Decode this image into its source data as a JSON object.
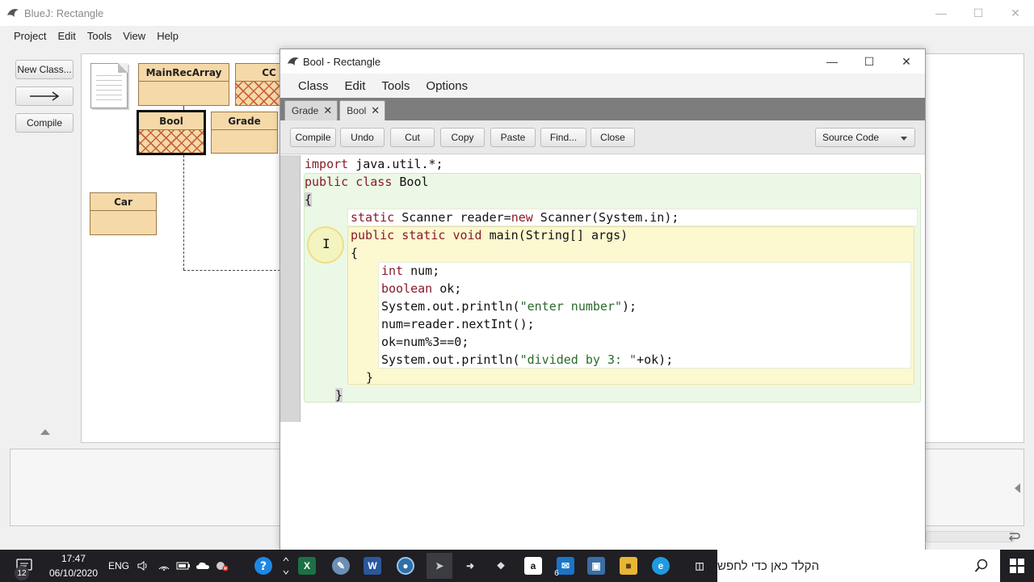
{
  "main_window": {
    "title": "BlueJ:  Rectangle",
    "menu": [
      "Project",
      "Edit",
      "Tools",
      "View",
      "Help"
    ],
    "toolbar": {
      "new_class": "New Class...",
      "compile": "Compile"
    }
  },
  "diagram": {
    "classes": {
      "main_rec_array": "MainRecArray",
      "cc": "CC",
      "bool": "Bool",
      "grade": "Grade",
      "car": "Car"
    }
  },
  "editor": {
    "title": "Bool - Rectangle",
    "menu": [
      "Class",
      "Edit",
      "Tools",
      "Options"
    ],
    "tabs": [
      {
        "label": "Grade",
        "close": "✕"
      },
      {
        "label": "Bool",
        "close": "✕"
      }
    ],
    "toolbar": {
      "compile": "Compile",
      "undo": "Undo",
      "cut": "Cut",
      "copy": "Copy",
      "paste": "Paste",
      "find": "Find...",
      "close": "Close",
      "view_mode": "Source Code"
    },
    "code": {
      "line1": {
        "kw": "import",
        "rest": " java.util.*;"
      },
      "line2": {
        "kw1": "public",
        "kw2": "class",
        "rest": " Bool"
      },
      "line3": "{",
      "line4": {
        "kw1": "static",
        "mid": " Scanner reader=",
        "kw2": "new",
        "rest": " Scanner(System.in);"
      },
      "line5": {
        "kw1": "public",
        "kw2": "static",
        "kw3": "void",
        "rest": " main(String[] args)"
      },
      "line6": "{",
      "line7": {
        "kw": "int",
        "rest": " num;"
      },
      "line8": {
        "kw": "boolean",
        "rest": " ok;"
      },
      "line9": {
        "pre": "System.out.println(",
        "str": "\"enter number\"",
        "post": ");"
      },
      "line10": "num=reader.nextInt();",
      "line11": "ok=num%3==0;",
      "line12": {
        "pre": "System.out.println(",
        "str": "\"divided by 3: \"",
        "post": "+ok);"
      },
      "line13": "}",
      "line14": "}"
    }
  },
  "taskbar": {
    "notification_count": "12",
    "time": "17:47",
    "date": "06/10/2020",
    "language": "ENG",
    "mail_badge": "6",
    "search_placeholder": "הקלד כאן כדי לחפש"
  },
  "colors": {
    "class_fill": "#f5d9a8",
    "hatch": "#c8603a",
    "keyword": "#8a1a2a",
    "string": "#2a6a2a",
    "scope_class": "#ecf8e6",
    "scope_method": "#fcf8cf",
    "taskbar": "#1f1f24"
  }
}
